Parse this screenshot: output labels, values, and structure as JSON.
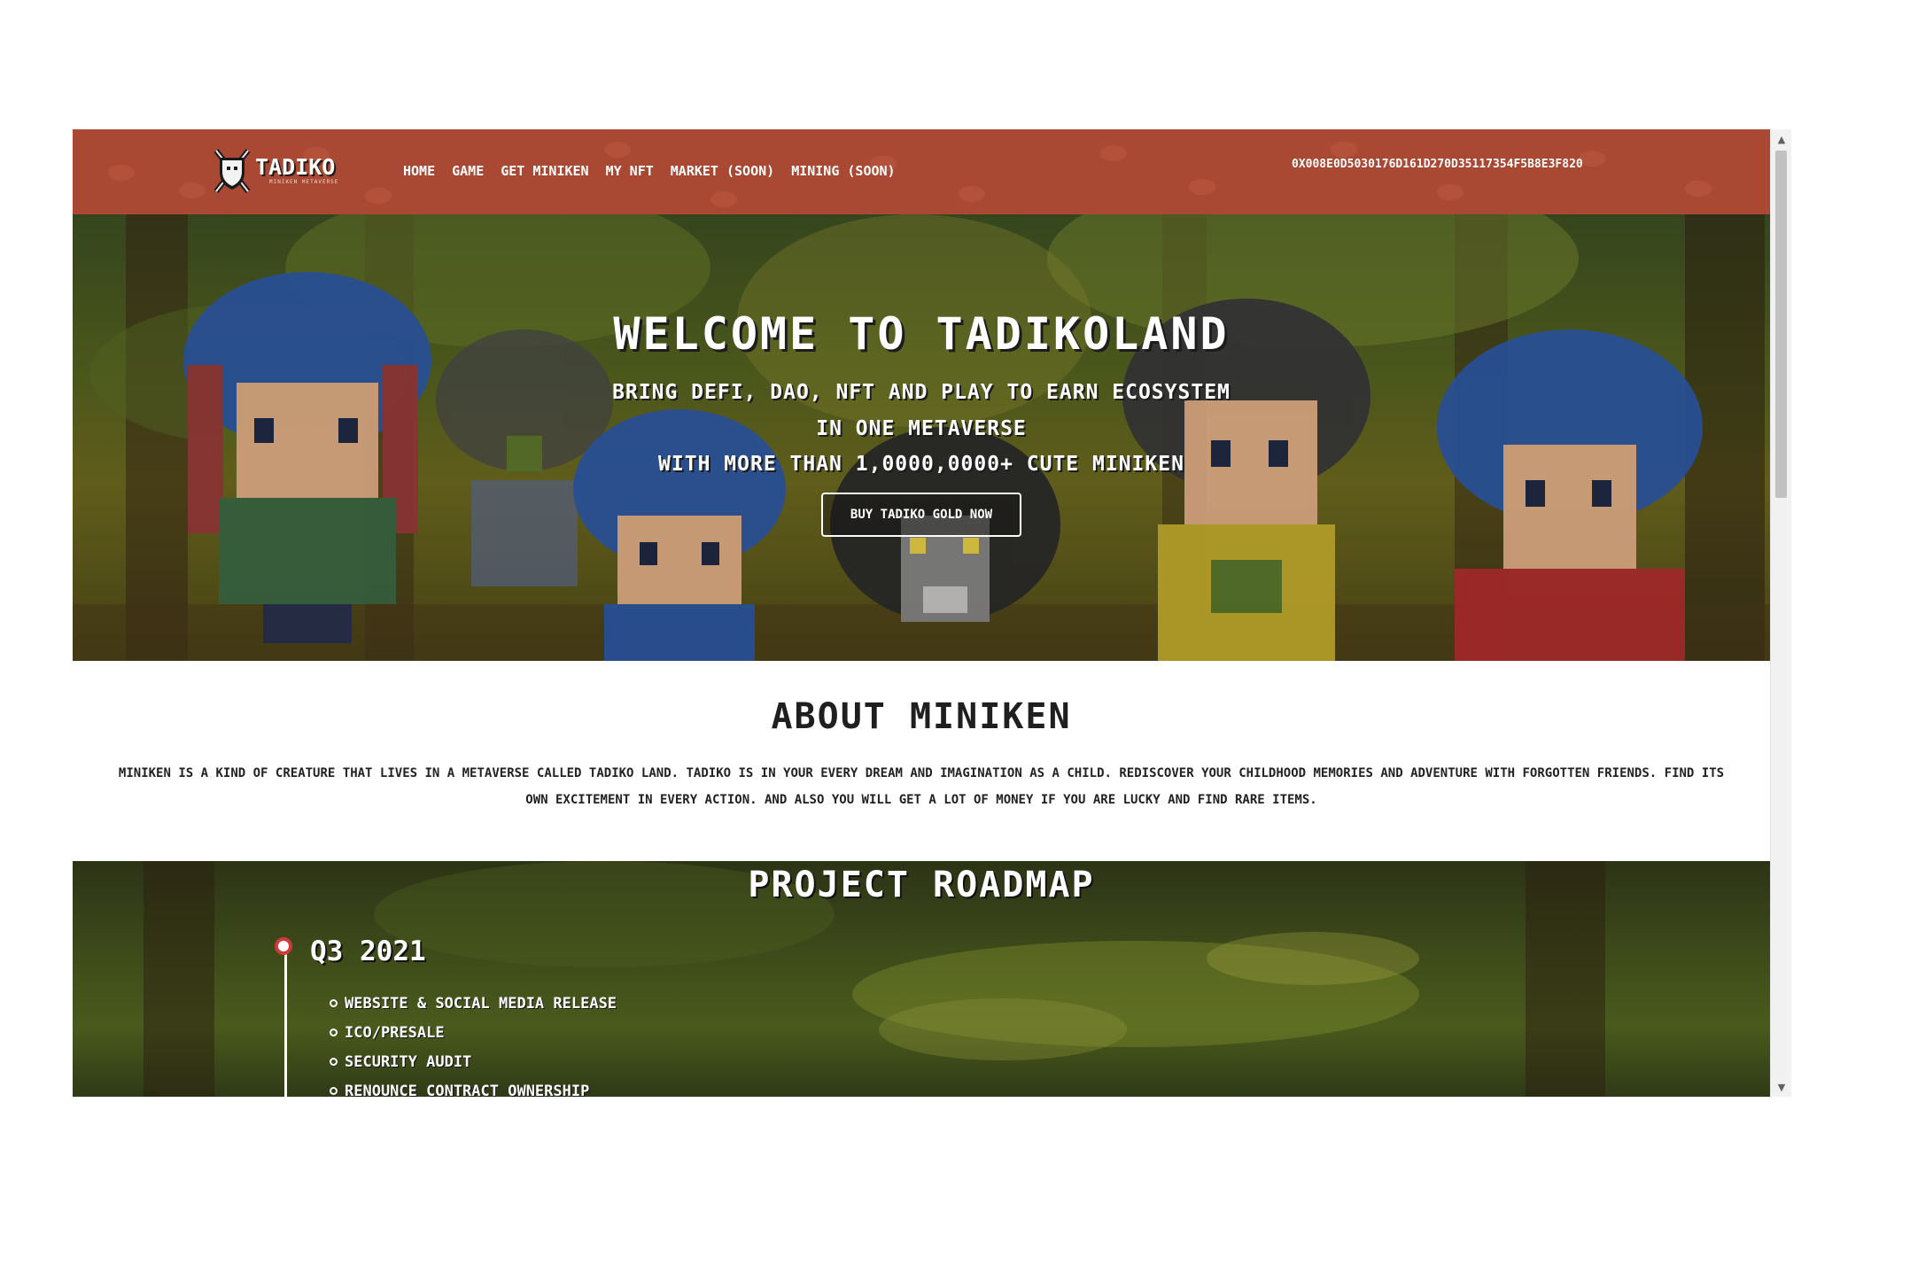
{
  "navbar": {
    "logo_text": "TADIKO",
    "logo_sub": "MINIKEN METAVERSE",
    "links": [
      {
        "label": "HOME"
      },
      {
        "label": "GAME"
      },
      {
        "label": "GET MINIKEN"
      },
      {
        "label": "MY NFT"
      },
      {
        "label": "MARKET (SOON)"
      },
      {
        "label": "MINING (SOON)"
      }
    ],
    "wallet_address": "0x008e0d5030176d161d270d35117354f5b8e3f820",
    "background_color": "#a94833"
  },
  "hero": {
    "title": "WELCOME TO TADIKOLAND",
    "line1": "BRING DEFI, DAO, NFT AND PLAY TO EARN ECOSYSTEM",
    "line2": "IN ONE METAVERSE",
    "line3": "WITH MORE THAN 1,0000,0000+ CUTE MINIKEN",
    "button_label": "BUY TADIKO GOLD NOW"
  },
  "about": {
    "title": "ABOUT MINIKEN",
    "text": "MINIKEN IS A KIND OF CREATURE THAT LIVES IN A METAVERSE CALLED TADIKO LAND. TADIKO IS IN YOUR EVERY DREAM AND IMAGINATION AS A CHILD. REDISCOVER YOUR CHILDHOOD MEMORIES AND ADVENTURE WITH FORGOTTEN FRIENDS. FIND ITS OWN EXCITEMENT IN EVERY ACTION. AND ALSO YOU WILL GET A LOT OF MONEY IF YOU ARE LUCKY AND FIND RARE ITEMS."
  },
  "roadmap": {
    "title": "PROJECT ROADMAP",
    "phases": [
      {
        "title": "Q3 2021",
        "items": [
          {
            "label": "WEBSITE & SOCIAL MEDIA RELEASE"
          },
          {
            "label": "ICO/PRESALE"
          },
          {
            "label": "SECURITY AUDIT"
          },
          {
            "label": "RENOUNCE CONTRACT OWNERSHIP"
          }
        ]
      }
    ],
    "dot_color": "#cf3b3b"
  },
  "scrollbar": {
    "up_icon": "triangle-up",
    "down_icon": "triangle-down"
  }
}
